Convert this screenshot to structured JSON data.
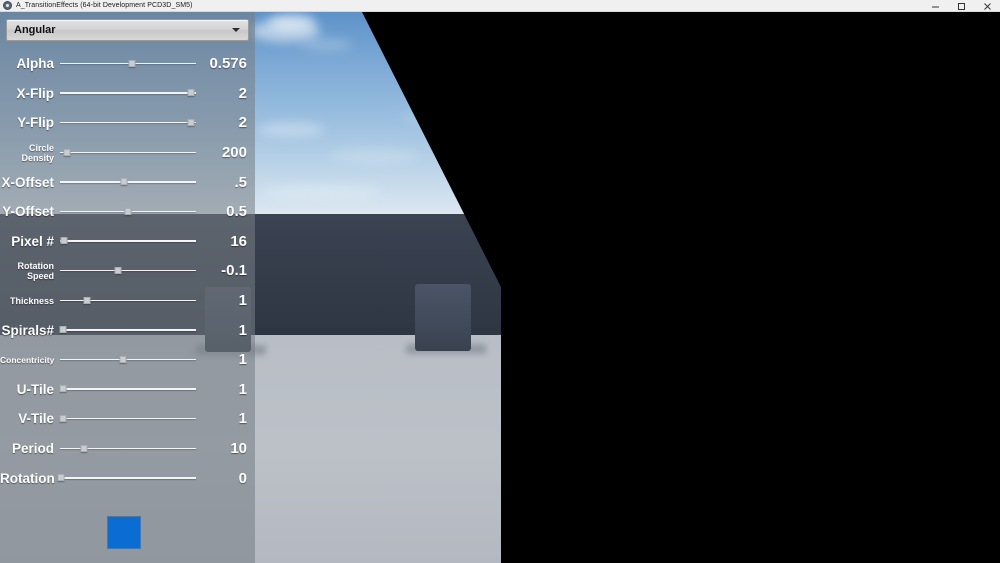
{
  "window": {
    "title": "A_TransitionEffects (64-bit Development PCD3D_SM5)",
    "icon": "app-icon",
    "controls": {
      "minimize": "minimize-icon",
      "maximize": "maximize-icon",
      "close": "close-icon"
    }
  },
  "panel": {
    "dropdown": {
      "selected": "Angular",
      "arrow_icon": "chevron-down-icon",
      "options": [
        "Angular"
      ]
    },
    "parameters": [
      {
        "label": "Alpha",
        "value": "0.576",
        "knob_pct": 53,
        "label_size": "normal"
      },
      {
        "label": "X-Flip",
        "value": "2",
        "knob_pct": 96,
        "label_size": "normal"
      },
      {
        "label": "Y-Flip",
        "value": "2",
        "knob_pct": 96,
        "label_size": "normal"
      },
      {
        "label": "Circle Density",
        "value": "200",
        "knob_pct": 5,
        "label_size": "small"
      },
      {
        "label": "X-Offset",
        "value": ".5",
        "knob_pct": 47,
        "label_size": "normal"
      },
      {
        "label": "Y-Offset",
        "value": "0.5",
        "knob_pct": 50,
        "label_size": "normal"
      },
      {
        "label": "Pixel #",
        "value": "16",
        "knob_pct": 3,
        "label_size": "normal"
      },
      {
        "label": "Rotation Speed",
        "value": "-0.1",
        "knob_pct": 43,
        "label_size": "small"
      },
      {
        "label": "Thickness",
        "value": "1",
        "knob_pct": 20,
        "label_size": "small"
      },
      {
        "label": "Spirals#",
        "value": "1",
        "knob_pct": 2,
        "label_size": "normal"
      },
      {
        "label": "Concentricity",
        "value": "1",
        "knob_pct": 46,
        "label_size": "tiny"
      },
      {
        "label": "U-Tile",
        "value": "1",
        "knob_pct": 2,
        "label_size": "normal"
      },
      {
        "label": "V-Tile",
        "value": "1",
        "knob_pct": 2,
        "label_size": "normal"
      },
      {
        "label": "Period",
        "value": "10",
        "knob_pct": 18,
        "label_size": "normal"
      },
      {
        "label": "Rotation",
        "value": "0",
        "knob_pct": 1,
        "label_size": "normal"
      }
    ],
    "color_swatch": {
      "name": "color-swatch",
      "color": "#0b6cd3"
    }
  },
  "viewport": {
    "name": "3d-viewport",
    "transition_effect": "Angular",
    "wipe_color": "#000000",
    "sky_color": "#5d92c8",
    "floor_color": "#b9bec6",
    "wall_color": "#3b4352"
  }
}
